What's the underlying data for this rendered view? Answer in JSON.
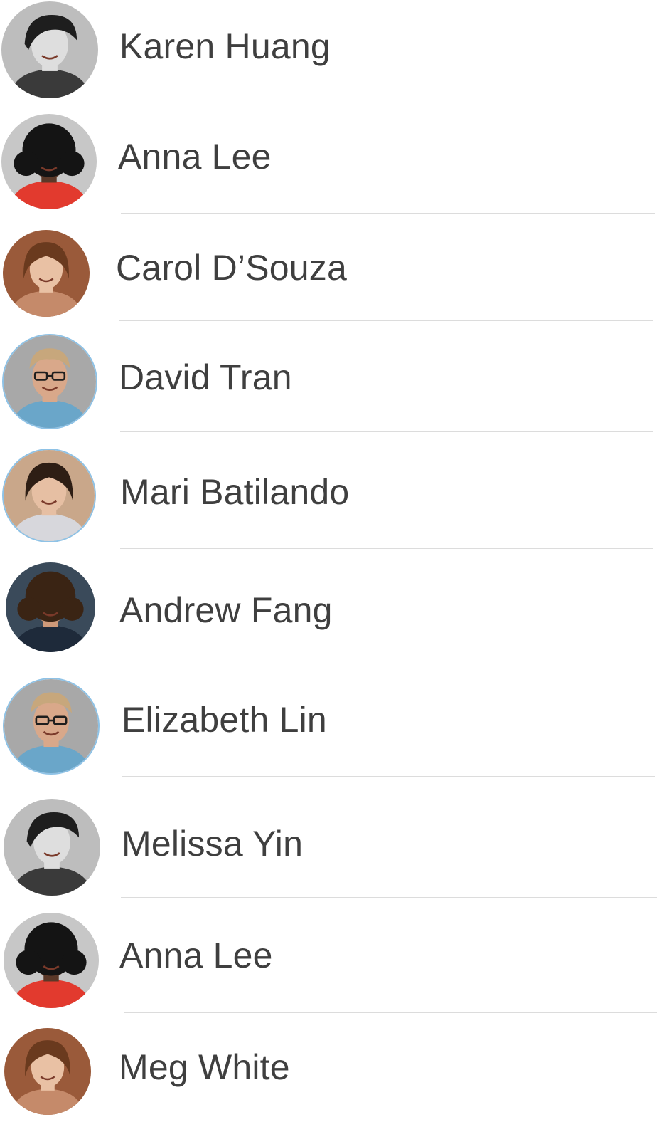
{
  "contacts": [
    {
      "name": "Karen Huang",
      "avatar": "bw-woman-short-hair",
      "palette": {
        "bg": "#bdbdbd",
        "hair": "#1e1e1e",
        "skin": "#dedede",
        "shirt": "#3a3a3a"
      }
    },
    {
      "name": "Anna Lee",
      "avatar": "woman-curly-hair-red-top",
      "palette": {
        "bg": "#c7c7c7",
        "hair": "#141414",
        "skin": "#5a3828",
        "shirt": "#e23a2e"
      }
    },
    {
      "name": "Carol D’Souza",
      "avatar": "woman-brown-hair-brick-wall",
      "palette": {
        "bg": "#9a5a3a",
        "hair": "#6a3a1e",
        "skin": "#e9c1a4",
        "shirt": "#c58a6a"
      }
    },
    {
      "name": "David Tran",
      "avatar": "man-glasses-blue-shirt",
      "palette": {
        "bg": "#a8a8a8",
        "hair": "#c7a77c",
        "skin": "#d9a88a",
        "shirt": "#6aa6c9"
      }
    },
    {
      "name": "Mari Batilando",
      "avatar": "woman-dark-hair-smiling",
      "palette": {
        "bg": "#c9a78a",
        "hair": "#2e1e14",
        "skin": "#e6bfa3",
        "shirt": "#d7d7dc"
      }
    },
    {
      "name": "Andrew Fang",
      "avatar": "woman-curly-hair-stadium",
      "palette": {
        "bg": "#3a4a5a",
        "hair": "#3a2414",
        "skin": "#cf9a7a",
        "shirt": "#1e2a3a"
      }
    },
    {
      "name": "Elizabeth Lin",
      "avatar": "man-glasses-blue-shirt",
      "palette": {
        "bg": "#a8a8a8",
        "hair": "#c7a77c",
        "skin": "#d9a88a",
        "shirt": "#6aa6c9"
      }
    },
    {
      "name": "Melissa Yin",
      "avatar": "bw-woman-short-hair",
      "palette": {
        "bg": "#bdbdbd",
        "hair": "#1e1e1e",
        "skin": "#dedede",
        "shirt": "#3a3a3a"
      }
    },
    {
      "name": "Anna Lee",
      "avatar": "woman-curly-hair-red-top",
      "palette": {
        "bg": "#c7c7c7",
        "hair": "#141414",
        "skin": "#5a3828",
        "shirt": "#e23a2e"
      }
    },
    {
      "name": "Meg White",
      "avatar": "woman-brown-hair-brick-wall",
      "palette": {
        "bg": "#9a5a3a",
        "hair": "#6a3a1e",
        "skin": "#e9c1a4",
        "shirt": "#c58a6a"
      }
    }
  ],
  "colors": {
    "text": "#3f3f3f",
    "divider": "#dcdcdc",
    "background": "#ffffff"
  }
}
